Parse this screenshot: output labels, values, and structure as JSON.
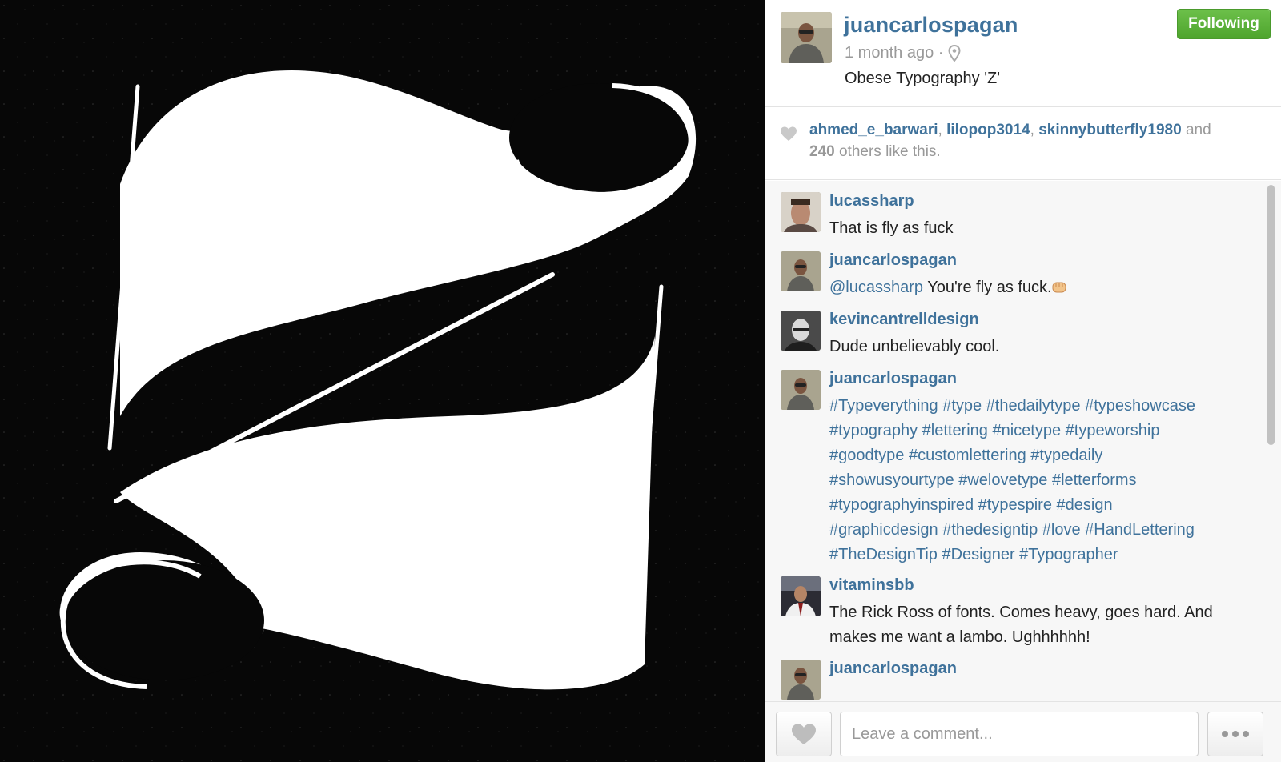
{
  "post": {
    "username": "juancarlospagan",
    "time": "1 month ago ·",
    "caption": "Obese Typography 'Z'",
    "follow_label": "Following"
  },
  "likes": {
    "users": [
      "ahmed_e_barwari",
      "lilopop3014",
      "skinnybutterfly1980"
    ],
    "sep1": ",",
    "sep2": ",",
    "and": "and",
    "count": "240",
    "suffix": "others like this."
  },
  "comments": [
    {
      "user": "lucassharp",
      "text": "That is fly as fuck"
    },
    {
      "user": "juancarlospagan",
      "mention": "@lucassharp",
      "text": "You're fly as fuck."
    },
    {
      "user": "kevincantrelldesign",
      "text": "Dude unbelievably cool."
    },
    {
      "user": "juancarlospagan",
      "lines": [
        "#Typeverything #type #thedailytype #typeshowcase",
        "#typography #lettering #nicetype #typeworship",
        "#goodtype #customlettering #typedaily",
        "#showusyourtype #welovetype #letterforms",
        "#typographyinspired #typespire #design",
        "#graphicdesign #thedesigntip #love #HandLettering",
        "#TheDesignTip #Designer #Typographer"
      ]
    },
    {
      "user": "vitaminsbb",
      "lines": [
        "The Rick Ross of fonts. Comes heavy, goes hard. And",
        "makes me want a lambo. Ughhhhhh!"
      ]
    },
    {
      "user": "juancarlospagan"
    }
  ],
  "footer": {
    "comment_placeholder": "Leave a comment..."
  },
  "icons": {
    "location": "location-pin-icon",
    "heart": "heart-icon",
    "more": "more-dots-icon"
  },
  "colors": {
    "link": "#3f729b",
    "follow_green": "#5cb23a"
  }
}
